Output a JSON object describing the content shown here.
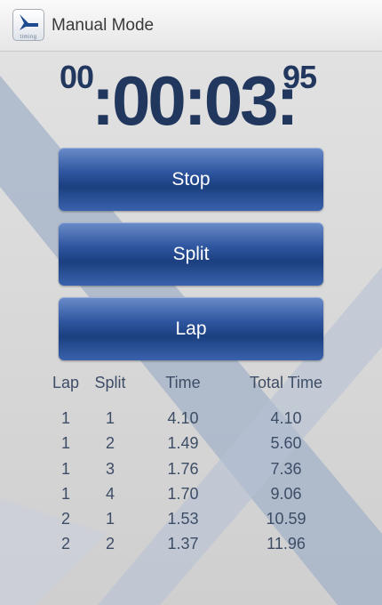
{
  "app": {
    "title": "Manual Mode",
    "icon_name": "timing-app-icon",
    "icon_label": "timing"
  },
  "timer": {
    "hours": "00",
    "main": ":00:03:",
    "hundredths": "95"
  },
  "buttons": {
    "stop": "Stop",
    "split": "Split",
    "lap": "Lap"
  },
  "table": {
    "headers": {
      "lap": "Lap",
      "split": "Split",
      "time": "Time",
      "total": "Total Time"
    },
    "rows": [
      {
        "lap": "1",
        "split": "1",
        "time": "4.10",
        "total": "4.10"
      },
      {
        "lap": "1",
        "split": "2",
        "time": "1.49",
        "total": "5.60"
      },
      {
        "lap": "1",
        "split": "3",
        "time": "1.76",
        "total": "7.36"
      },
      {
        "lap": "1",
        "split": "4",
        "time": "1.70",
        "total": "9.06"
      },
      {
        "lap": "2",
        "split": "1",
        "time": "1.53",
        "total": "10.59"
      },
      {
        "lap": "2",
        "split": "2",
        "time": "1.37",
        "total": "11.96"
      }
    ]
  },
  "colors": {
    "accent": "#22375e",
    "button": "#2f56a0",
    "text": "#3d4d66"
  }
}
